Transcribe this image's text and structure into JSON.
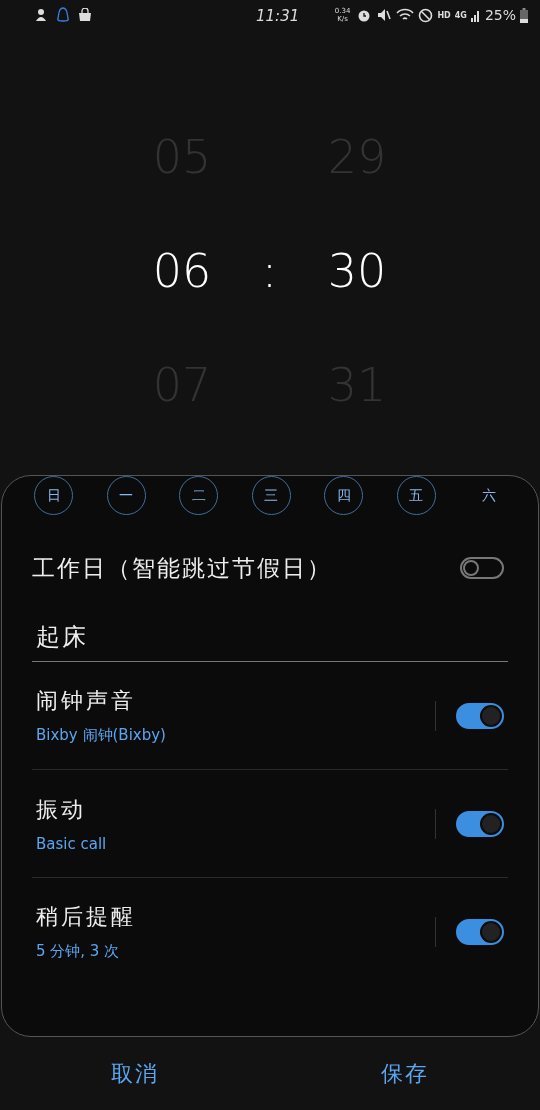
{
  "status_bar": {
    "time": "11:31",
    "speed": "0.34",
    "speed_unit": "K/s",
    "battery": "25%",
    "network": "4G",
    "hd": "HD"
  },
  "picker": {
    "hours": [
      "05",
      "06",
      "07"
    ],
    "minutes": [
      "29",
      "30",
      "31"
    ],
    "separator": ":"
  },
  "days": [
    {
      "label": "日",
      "selected": true
    },
    {
      "label": "一",
      "selected": true
    },
    {
      "label": "二",
      "selected": true
    },
    {
      "label": "三",
      "selected": true
    },
    {
      "label": "四",
      "selected": true
    },
    {
      "label": "五",
      "selected": true
    },
    {
      "label": "六",
      "selected": false
    }
  ],
  "workday": {
    "label": "工作日（智能跳过节假日）",
    "on": false
  },
  "alarm_name": {
    "value": "起床"
  },
  "settings": [
    {
      "title": "闹钟声音",
      "value": "Bixby 闹钟(Bixby)",
      "on": true
    },
    {
      "title": "振动",
      "value": "Basic call",
      "on": true
    },
    {
      "title": "稍后提醒",
      "value": "5 分钟, 3 次",
      "on": true
    }
  ],
  "buttons": [
    "取消",
    "保存"
  ]
}
